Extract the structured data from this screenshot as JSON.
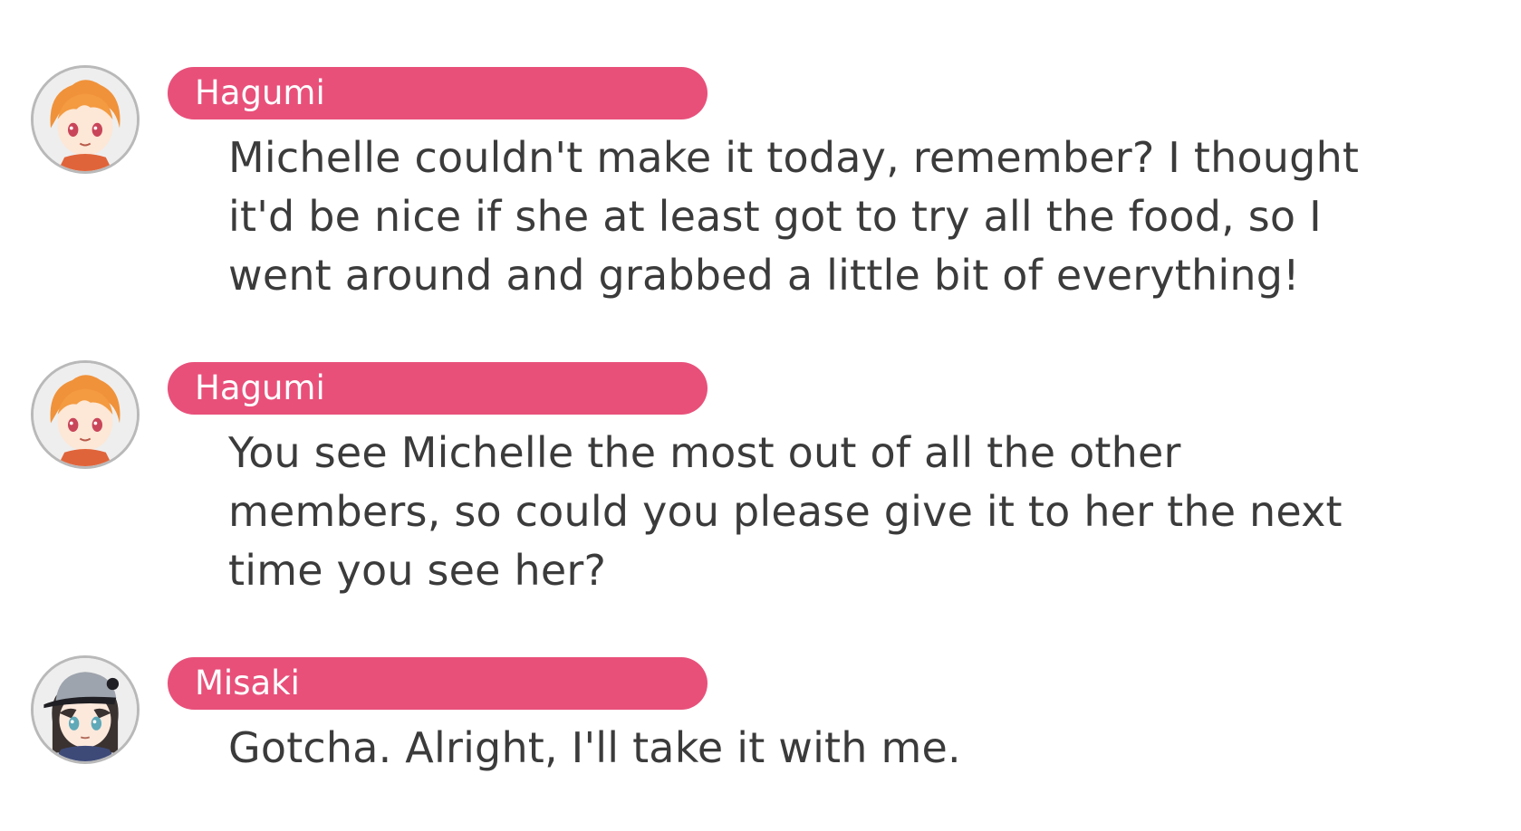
{
  "dialogue": [
    {
      "speaker": "Hagumi",
      "avatar_icon": "hagumi-avatar-icon",
      "lines": [
        "Michelle couldn't make it today, remember? I thought",
        "it'd be nice if she at least got to try all the food, so I",
        "went around and grabbed a little bit of everything!"
      ]
    },
    {
      "speaker": "Hagumi",
      "avatar_icon": "hagumi-avatar-icon",
      "lines": [
        "You see Michelle the most out of all the other",
        "members, so could you please give it to her the next",
        "time you see her?"
      ]
    },
    {
      "speaker": "Misaki",
      "avatar_icon": "misaki-avatar-icon",
      "lines": [
        "Gotcha. Alright, I'll take it with me."
      ]
    }
  ],
  "colors": {
    "nameplate": "#e8507a",
    "nameplate_text": "#ffffff",
    "dialogue_text": "#3b3b3b",
    "avatar_border": "#b9b9b9"
  }
}
